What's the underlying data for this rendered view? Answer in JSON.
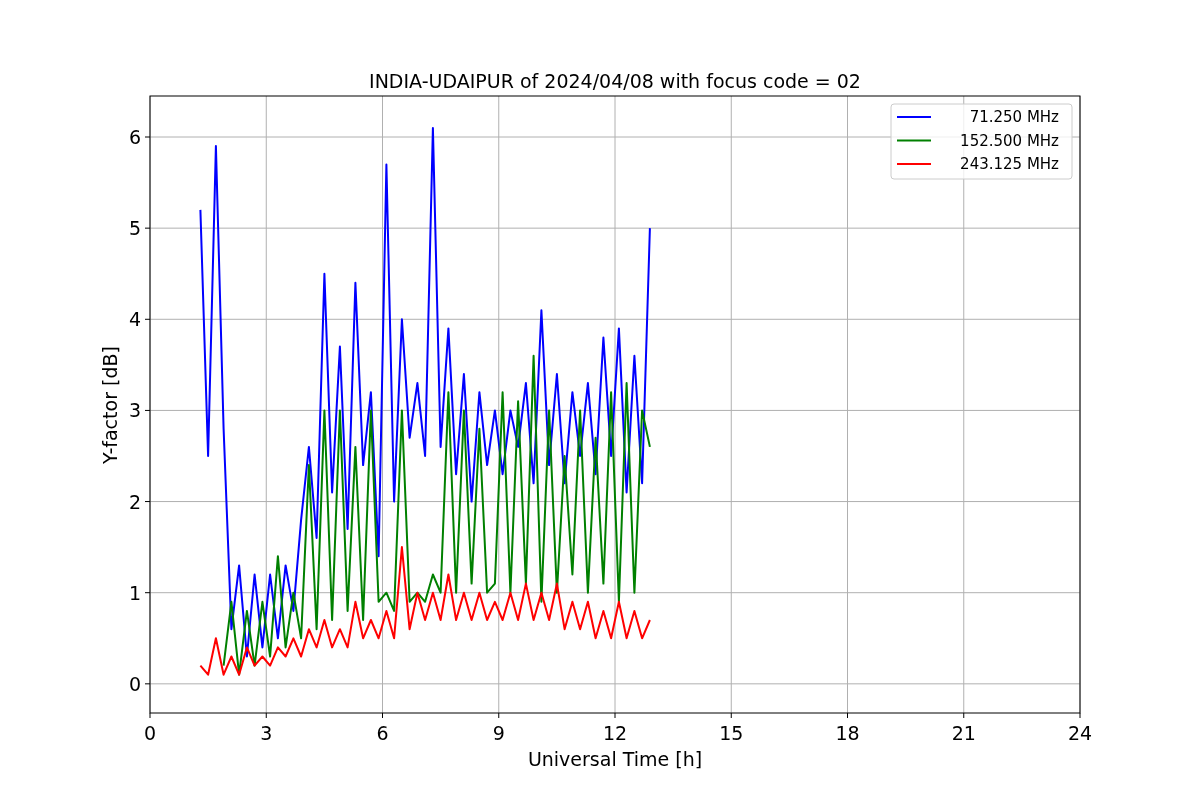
{
  "chart": {
    "chart_data": {
      "type": "line",
      "title": "INDIA-UDAIPUR of 2024/04/08 with focus code = 02",
      "xlabel": "Universal Time [h]",
      "ylabel": "Y-factor [dB]",
      "xlim": [
        0,
        24
      ],
      "ylim": [
        -0.32,
        6.45
      ],
      "xticks": [
        0,
        3,
        6,
        9,
        12,
        15,
        18,
        21,
        24
      ],
      "yticks": [
        0,
        1,
        2,
        3,
        4,
        5,
        6
      ],
      "grid": true,
      "legend": "upper right",
      "x": [
        1.3,
        1.5,
        1.7,
        1.9,
        2.1,
        2.3,
        2.5,
        2.7,
        2.9,
        3.1,
        3.3,
        3.5,
        3.7,
        3.9,
        4.1,
        4.3,
        4.5,
        4.7,
        4.9,
        5.1,
        5.3,
        5.5,
        5.7,
        5.9,
        6.1,
        6.3,
        6.5,
        6.7,
        6.9,
        7.1,
        7.3,
        7.5,
        7.7,
        7.9,
        8.1,
        8.3,
        8.5,
        8.7,
        8.9,
        9.1,
        9.3,
        9.5,
        9.7,
        9.9,
        10.1,
        10.3,
        10.5,
        10.7,
        10.9,
        11.1,
        11.3,
        11.5,
        11.7,
        11.9,
        12.1,
        12.3,
        12.5,
        12.7,
        12.9
      ],
      "series": [
        {
          "name": "71.250 MHz",
          "color": "#0000ff",
          "values": [
            5.2,
            2.5,
            5.9,
            2.8,
            0.6,
            1.3,
            0.3,
            1.2,
            0.4,
            1.2,
            0.5,
            1.3,
            0.8,
            1.8,
            2.6,
            1.6,
            4.5,
            2.1,
            3.7,
            1.7,
            4.4,
            2.4,
            3.2,
            1.4,
            5.7,
            2.0,
            4.0,
            2.7,
            3.3,
            2.5,
            6.1,
            2.6,
            3.9,
            2.3,
            3.4,
            2.0,
            3.2,
            2.4,
            3.0,
            2.3,
            3.0,
            2.6,
            3.3,
            2.2,
            4.1,
            2.4,
            3.4,
            2.2,
            3.2,
            2.5,
            3.3,
            2.3,
            3.8,
            2.5,
            3.9,
            2.1,
            3.6,
            2.2,
            5.0
          ]
        },
        {
          "name": "152.500 MHz",
          "color": "#008000",
          "values": [
            null,
            null,
            null,
            0.2,
            0.9,
            0.1,
            0.8,
            0.2,
            0.9,
            0.3,
            1.4,
            0.4,
            1.0,
            0.5,
            2.4,
            0.6,
            3.0,
            0.7,
            3.0,
            0.8,
            2.6,
            0.7,
            3.0,
            0.9,
            1.0,
            0.8,
            3.0,
            0.9,
            1.0,
            0.9,
            1.2,
            1.0,
            3.2,
            1.0,
            3.0,
            1.1,
            2.8,
            1.0,
            1.1,
            3.2,
            1.0,
            3.1,
            1.1,
            3.6,
            0.9,
            3.0,
            1.0,
            2.5,
            1.2,
            3.0,
            1.0,
            2.7,
            1.1,
            3.2,
            0.9,
            3.3,
            1.0,
            3.0,
            2.6
          ]
        },
        {
          "name": "243.125 MHz",
          "color": "#ff0000",
          "values": [
            0.2,
            0.1,
            0.5,
            0.1,
            0.3,
            0.1,
            0.4,
            0.2,
            0.3,
            0.2,
            0.4,
            0.3,
            0.5,
            0.3,
            0.6,
            0.4,
            0.7,
            0.4,
            0.6,
            0.4,
            0.9,
            0.5,
            0.7,
            0.5,
            0.8,
            0.5,
            1.5,
            0.6,
            1.0,
            0.7,
            1.0,
            0.7,
            1.2,
            0.7,
            1.0,
            0.7,
            1.0,
            0.7,
            0.9,
            0.7,
            1.0,
            0.7,
            1.1,
            0.7,
            1.0,
            0.7,
            1.1,
            0.6,
            0.9,
            0.6,
            0.9,
            0.5,
            0.8,
            0.5,
            0.9,
            0.5,
            0.8,
            0.5,
            0.7
          ]
        }
      ]
    }
  }
}
